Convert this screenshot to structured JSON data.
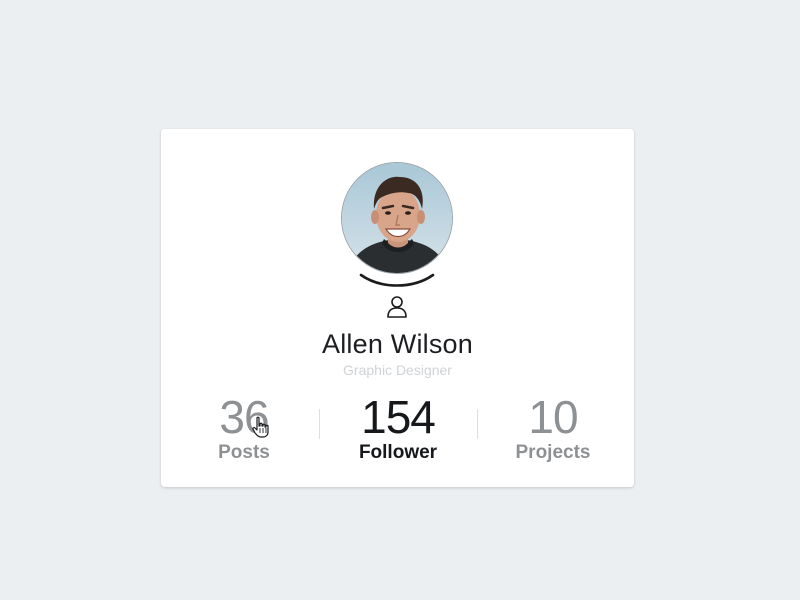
{
  "profile": {
    "name": "Allen Wilson",
    "role": "Graphic Designer"
  },
  "stats": [
    {
      "value": "36",
      "label": "Posts"
    },
    {
      "value": "154",
      "label": "Follower"
    },
    {
      "value": "10",
      "label": "Projects"
    }
  ],
  "colors": {
    "background": "#eceff2",
    "card": "#ffffff",
    "active_text": "#16181b",
    "inactive_text": "#8e9194",
    "role_text": "#cfd3d6"
  },
  "icons": {
    "user": "user-icon",
    "cursor": "hand-pointer-icon"
  }
}
